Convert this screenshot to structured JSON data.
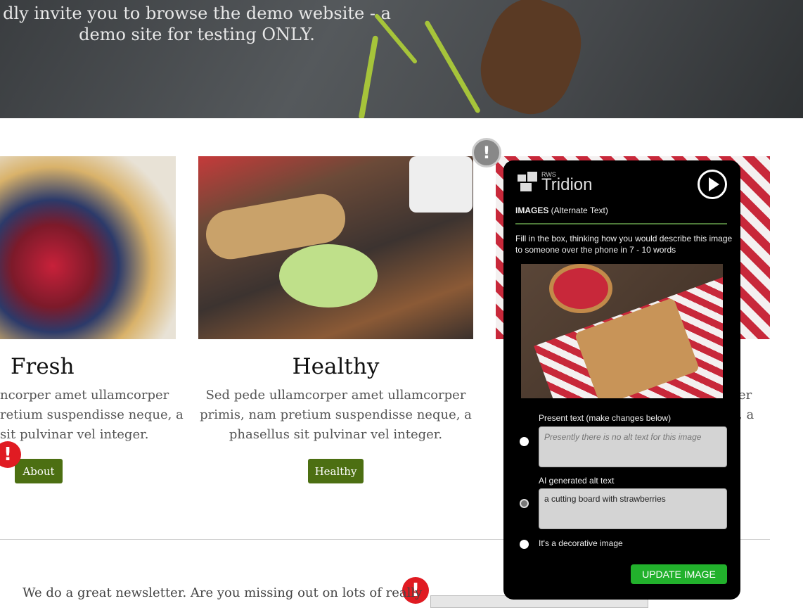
{
  "hero": {
    "line1": "dly invite you to browse the demo website - a",
    "line2": "demo site for testing ONLY."
  },
  "cards": [
    {
      "title": "Fresh",
      "text": "ncorper amet ullamcorper\nretium suspendisse neque, a\nsit pulvinar vel integer.",
      "button": "About"
    },
    {
      "title": "Healthy",
      "text": "Sed pede ullamcorper amet ullamcorper\nprimis, nam pretium suspendisse neque, a\nphasellus sit pulvinar vel integer.",
      "button": "Healthy"
    },
    {
      "text_fragment_1": "er",
      "text_fragment_2": ", a"
    }
  ],
  "newsletter": "We do a great newsletter. Are you missing out on lots of really",
  "alert_icon": "!",
  "panel": {
    "brand_small": "RWS",
    "brand": "Tridion",
    "section_bold": "IMAGES",
    "section_rest": " (Alternate Text)",
    "instructions": "Fill in the box, thinking how you would describe this image to someone over the phone in 7 - 10 words",
    "present_label": "Present text (make changes below)",
    "present_placeholder": "Presently there is no alt text for this image",
    "ai_label": "AI generated alt text",
    "ai_value": "a cutting board with strawberries",
    "decorative_label": "It's a decorative image",
    "selected": "ai",
    "update_button": "UPDATE IMAGE"
  },
  "colors": {
    "button_green": "#4c6f12",
    "update_green": "#22b12c",
    "alert_red": "#e01b22"
  }
}
